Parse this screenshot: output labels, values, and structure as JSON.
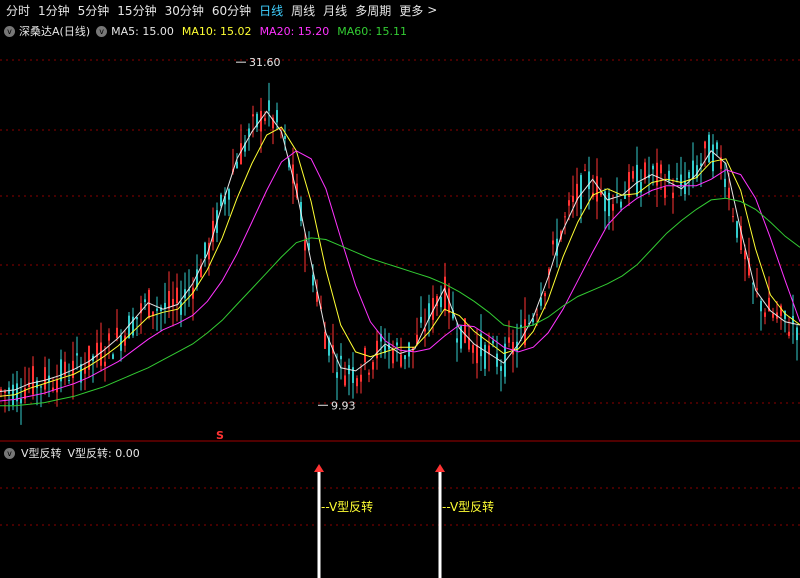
{
  "toolbar": {
    "tabs": [
      "分时",
      "1分钟",
      "5分钟",
      "15分钟",
      "30分钟",
      "60分钟",
      "日线",
      "周线",
      "月线",
      "多周期",
      "更多"
    ],
    "active_tab": "日线",
    "more_arrow": ">"
  },
  "chart_legend": {
    "stock_name": "深桑达A",
    "period": "(日线)",
    "ma5_label": "MA5: 15.00",
    "ma10_label": "MA10: 15.02",
    "ma20_label": "MA20: 15.20",
    "ma60_label": "MA60: 15.11"
  },
  "colors": {
    "ma5": "#e6e6e6",
    "ma10": "#ffff33",
    "ma20": "#ff33ff",
    "ma60": "#33cc33",
    "up": "#ff3333",
    "down": "#33cccc",
    "signal": "#ffff33",
    "grid": "#8b0000"
  },
  "annotations": {
    "high_label": "31.60",
    "low_label": "9.93",
    "marker_s": "S"
  },
  "sub_indicator": {
    "name": "V型反转",
    "value_label": "V型反转: 0.00",
    "signal_label_1": "V型反转",
    "signal_label_2": "V型反转"
  },
  "chart_data": {
    "type": "line",
    "title": "深桑达A (日线)",
    "series": [
      {
        "name": "MA5",
        "values": [
          10.8,
          10.9,
          11.3,
          11.5,
          11.8,
          12.2,
          12.7,
          13.4,
          14.2,
          15.3,
          16.4,
          16.0,
          16.3,
          17.6,
          19.5,
          22.6,
          25.5,
          27.2,
          28.5,
          27.2,
          23.5,
          19.0,
          14.5,
          12.3,
          12.1,
          12.8,
          13.8,
          13.2,
          13.5,
          15.5,
          17.3,
          14.8,
          13.8,
          13.2,
          12.6,
          13.8,
          15.5,
          18.0,
          21.0,
          23.0,
          24.2,
          22.9,
          23.2,
          24.0,
          24.5,
          24.1,
          23.6,
          24.5,
          26.0,
          25.2,
          21.0,
          17.2,
          15.9,
          15.2,
          15.0
        ]
      },
      {
        "name": "MA10",
        "values": [
          10.5,
          10.6,
          11.0,
          11.3,
          11.6,
          11.9,
          12.4,
          13.0,
          13.7,
          14.6,
          15.5,
          15.8,
          16.0,
          17.0,
          18.5,
          20.5,
          23.0,
          25.2,
          27.0,
          27.5,
          26.0,
          22.8,
          18.5,
          15.0,
          13.3,
          13.0,
          13.3,
          13.6,
          13.6,
          14.6,
          16.0,
          15.6,
          14.6,
          13.9,
          13.2,
          13.5,
          14.6,
          16.6,
          19.3,
          21.5,
          23.2,
          23.6,
          23.2,
          23.3,
          24.0,
          24.2,
          24.0,
          24.3,
          25.3,
          25.5,
          23.5,
          19.8,
          16.9,
          15.7,
          15.02
        ]
      },
      {
        "name": "MA20",
        "values": [
          10.2,
          10.3,
          10.5,
          10.7,
          11.0,
          11.3,
          11.7,
          12.2,
          12.7,
          13.4,
          14.1,
          14.7,
          15.1,
          15.6,
          16.5,
          17.8,
          19.5,
          21.5,
          23.5,
          25.3,
          26.0,
          25.5,
          23.6,
          20.5,
          17.5,
          15.2,
          14.0,
          13.4,
          13.3,
          13.5,
          14.3,
          15.0,
          14.9,
          14.3,
          13.6,
          13.3,
          13.6,
          14.5,
          16.0,
          17.8,
          19.6,
          21.3,
          22.3,
          23.0,
          23.5,
          23.8,
          23.8,
          23.8,
          24.2,
          24.8,
          24.5,
          23.0,
          20.5,
          17.8,
          15.2
        ]
      },
      {
        "name": "MA60",
        "values": [
          9.9,
          9.9,
          10.0,
          10.1,
          10.3,
          10.5,
          10.8,
          11.1,
          11.5,
          11.9,
          12.3,
          12.8,
          13.3,
          13.8,
          14.5,
          15.3,
          16.3,
          17.3,
          18.3,
          19.3,
          20.2,
          20.5,
          20.4,
          20.0,
          19.6,
          19.2,
          18.9,
          18.6,
          18.3,
          18.0,
          17.6,
          17.1,
          16.5,
          15.8,
          15.0,
          14.8,
          15.0,
          15.5,
          16.2,
          16.8,
          17.2,
          17.6,
          18.1,
          18.8,
          19.8,
          20.8,
          21.6,
          22.3,
          22.9,
          23.0,
          22.8,
          22.3,
          21.5,
          20.6,
          19.9
        ]
      }
    ],
    "price_high": 31.6,
    "price_low": 9.93,
    "sub_signals_at_index": [
      20,
      33
    ]
  }
}
